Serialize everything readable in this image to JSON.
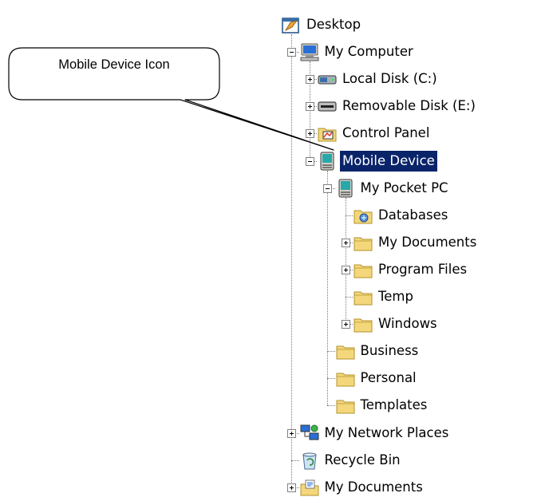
{
  "callout": {
    "text": "Mobile Device Icon"
  },
  "tree": [
    {
      "id": "desktop",
      "label": "Desktop",
      "icon": "desktop-icon",
      "depth": 0,
      "toggle": "none",
      "selected": false
    },
    {
      "id": "my-computer",
      "label": "My Computer",
      "icon": "computer-icon",
      "depth": 1,
      "toggle": "minus",
      "selected": false
    },
    {
      "id": "local-disk",
      "label": "Local Disk (C:)",
      "icon": "hard-disk-icon",
      "depth": 2,
      "toggle": "plus",
      "selected": false
    },
    {
      "id": "removable-disk",
      "label": "Removable Disk (E:)",
      "icon": "removable-disk-icon",
      "depth": 2,
      "toggle": "plus",
      "selected": false
    },
    {
      "id": "control-panel",
      "label": "Control Panel",
      "icon": "control-panel-icon",
      "depth": 2,
      "toggle": "plus",
      "selected": false
    },
    {
      "id": "mobile-device",
      "label": "Mobile Device",
      "icon": "mobile-device-icon",
      "depth": 2,
      "toggle": "minus",
      "selected": true
    },
    {
      "id": "my-pocket-pc",
      "label": "My Pocket PC",
      "icon": "mobile-device-icon",
      "depth": 3,
      "toggle": "minus",
      "selected": false
    },
    {
      "id": "databases",
      "label": "Databases",
      "icon": "database-folder-icon",
      "depth": 4,
      "toggle": "none",
      "selected": false
    },
    {
      "id": "pocket-my-documents",
      "label": "My Documents",
      "icon": "folder-icon",
      "depth": 4,
      "toggle": "plus",
      "selected": false
    },
    {
      "id": "program-files",
      "label": "Program Files",
      "icon": "folder-icon",
      "depth": 4,
      "toggle": "plus",
      "selected": false
    },
    {
      "id": "temp",
      "label": "Temp",
      "icon": "folder-icon",
      "depth": 4,
      "toggle": "none",
      "selected": false
    },
    {
      "id": "windows",
      "label": "Windows",
      "icon": "folder-icon",
      "depth": 4,
      "toggle": "plus",
      "selected": false
    },
    {
      "id": "business",
      "label": "Business",
      "icon": "folder-icon",
      "depth": 3,
      "toggle": "none",
      "selected": false
    },
    {
      "id": "personal",
      "label": "Personal",
      "icon": "folder-icon",
      "depth": 3,
      "toggle": "none",
      "selected": false
    },
    {
      "id": "templates",
      "label": "Templates",
      "icon": "folder-icon",
      "depth": 3,
      "toggle": "none",
      "selected": false
    },
    {
      "id": "my-network-places",
      "label": "My Network Places",
      "icon": "network-places-icon",
      "depth": 1,
      "toggle": "plus",
      "selected": false
    },
    {
      "id": "recycle-bin",
      "label": "Recycle Bin",
      "icon": "recycle-bin-icon",
      "depth": 1,
      "toggle": "none",
      "selected": false
    },
    {
      "id": "desktop-my-documents",
      "label": "My Documents",
      "icon": "my-documents-icon",
      "depth": 1,
      "toggle": "plus",
      "selected": false
    }
  ],
  "colors": {
    "selection": "#0a246a",
    "folder": "#f3d77a",
    "folder_edge": "#b3932f"
  }
}
